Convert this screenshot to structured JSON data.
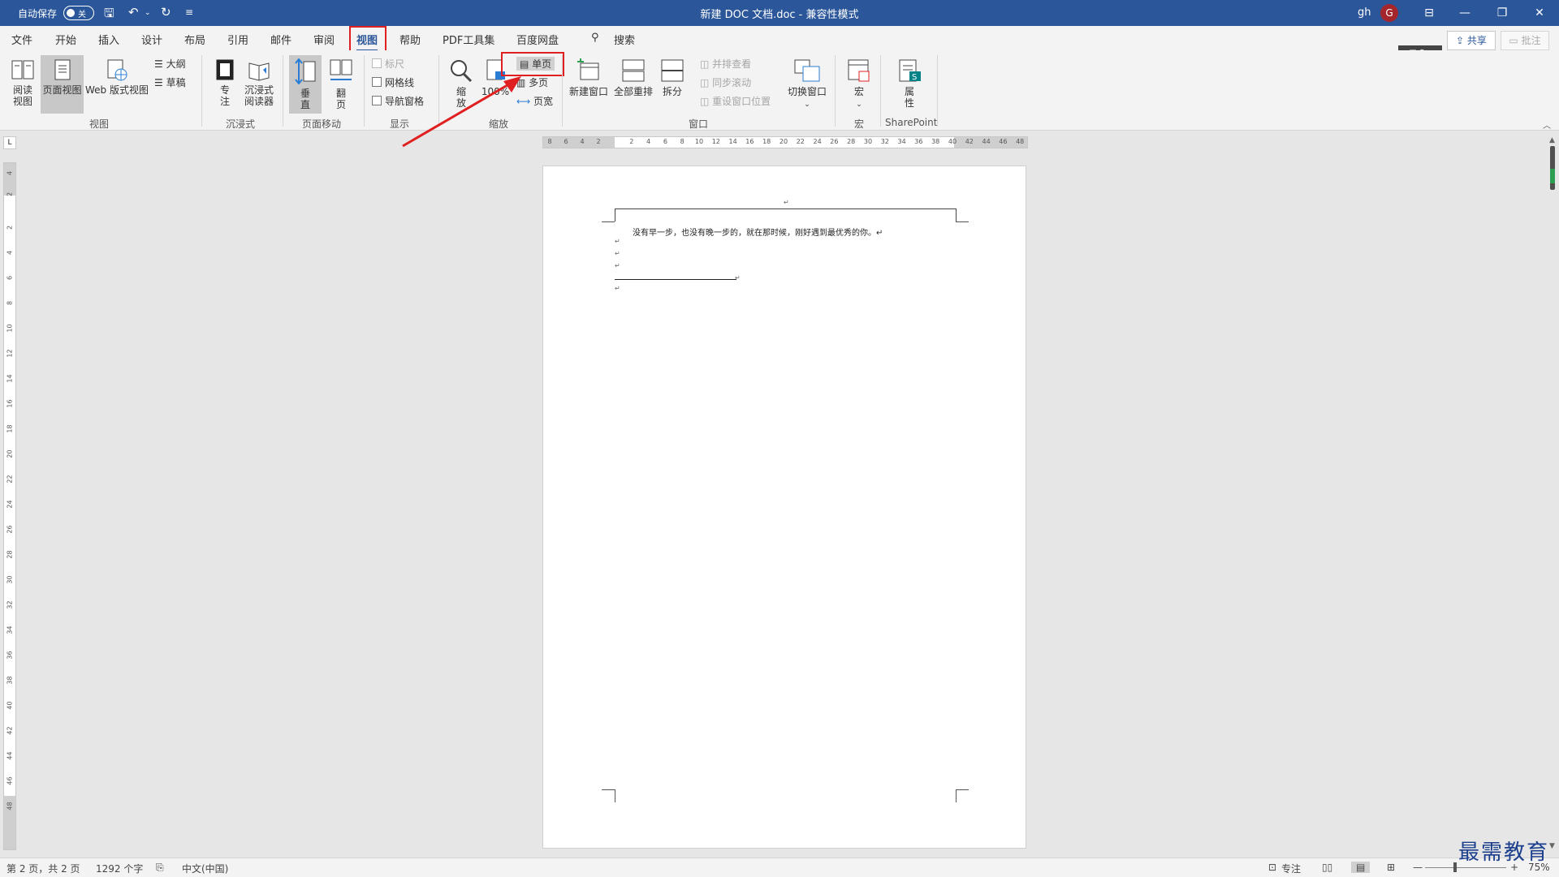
{
  "titlebar": {
    "autosave_label": "自动保存",
    "autosave_state": "关",
    "doc_title": "新建 DOC 文档.doc  -  兼容性模式",
    "user_name": "gh",
    "avatar_initial": "G"
  },
  "tabs": [
    "文件",
    "开始",
    "插入",
    "设计",
    "布局",
    "引用",
    "邮件",
    "审阅",
    "视图",
    "帮助",
    "PDF工具集",
    "百度网盘"
  ],
  "active_tab": "视图",
  "search_label": "搜索",
  "share_label": "共享",
  "comments_label": "批注",
  "ribbon": {
    "views": {
      "read_mode": "阅读\n视图",
      "print_layout": "页面视图",
      "web_layout": "Web 版式视图",
      "outline": "大纲",
      "draft": "草稿",
      "group": "视图"
    },
    "immersive": {
      "focus": "专\n注",
      "immersive_reader": "沉浸式\n阅读器",
      "group": "沉浸式"
    },
    "page_movement": {
      "vertical": "垂\n直",
      "side_to_side": "翻\n页",
      "group": "页面移动"
    },
    "show": {
      "ruler": "标尺",
      "gridlines": "网格线",
      "nav_pane": "导航窗格",
      "group": "显示"
    },
    "zoom": {
      "zoom": "缩\n放",
      "hundred": "100%",
      "one_page": "单页",
      "multiple_pages": "多页",
      "page_width": "页宽",
      "group": "缩放"
    },
    "window": {
      "new_window": "新建窗口",
      "arrange_all": "全部重排",
      "split": "拆分",
      "side_by_side": "并排查看",
      "sync_scroll": "同步滚动",
      "reset_position": "重设窗口位置",
      "switch_windows": "切换窗口",
      "group": "窗口"
    },
    "macros": {
      "macros": "宏",
      "group": "宏"
    },
    "sharepoint": {
      "properties": "属\n性",
      "group": "SharePoint"
    }
  },
  "document": {
    "body_text": "没有早一步，也没有晚一步的，就在那时候，刚好遇到最优秀的你。↵",
    "para_mark": "↵"
  },
  "status": {
    "page": "第 2 页，共 2 页",
    "words": "1292 个字",
    "language": "中文(中国)",
    "focus": "专注",
    "zoom": "75%"
  },
  "watermark": "最需教育",
  "colors": {
    "brand": "#2b579a",
    "highlight": "#e02020"
  }
}
